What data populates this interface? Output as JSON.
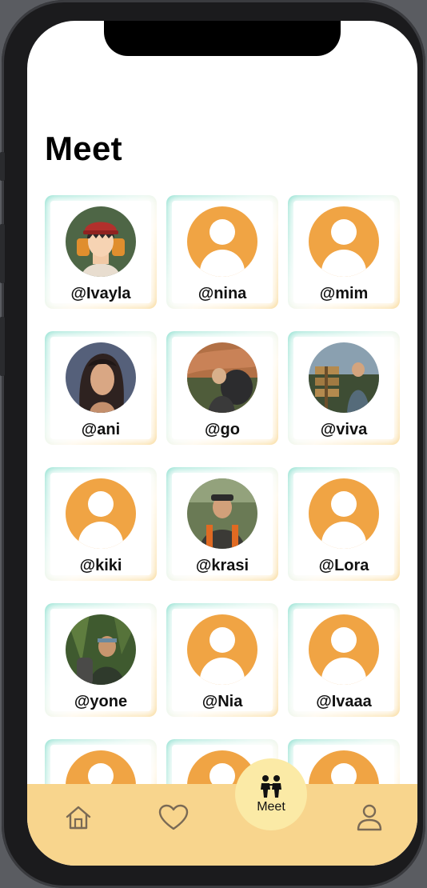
{
  "screen": {
    "title": "Meet"
  },
  "people": [
    {
      "handle": "@Ivayla",
      "avatar": "cartoon-photo"
    },
    {
      "handle": "@nina",
      "avatar": "default"
    },
    {
      "handle": "@mim",
      "avatar": "default"
    },
    {
      "handle": "@ani",
      "avatar": "photo"
    },
    {
      "handle": "@go",
      "avatar": "photo"
    },
    {
      "handle": "@viva",
      "avatar": "photo"
    },
    {
      "handle": "@kiki",
      "avatar": "default"
    },
    {
      "handle": "@krasi",
      "avatar": "photo"
    },
    {
      "handle": "@Lora",
      "avatar": "default"
    },
    {
      "handle": "@yone",
      "avatar": "photo"
    },
    {
      "handle": "@Nia",
      "avatar": "default"
    },
    {
      "handle": "@Ivaaa",
      "avatar": "default"
    }
  ],
  "tabbar": {
    "items": [
      {
        "icon": "home-icon"
      },
      {
        "icon": "heart-icon"
      },
      {
        "icon": "meet-people-icon",
        "label": "Meet"
      },
      {
        "icon": "profile-icon"
      }
    ]
  },
  "colors": {
    "accent_orange": "#f0a444",
    "tabbar_bg": "#f8d58d",
    "card_gradient_teal": "#7edcc9",
    "card_gradient_yellow": "#f8d58d"
  }
}
